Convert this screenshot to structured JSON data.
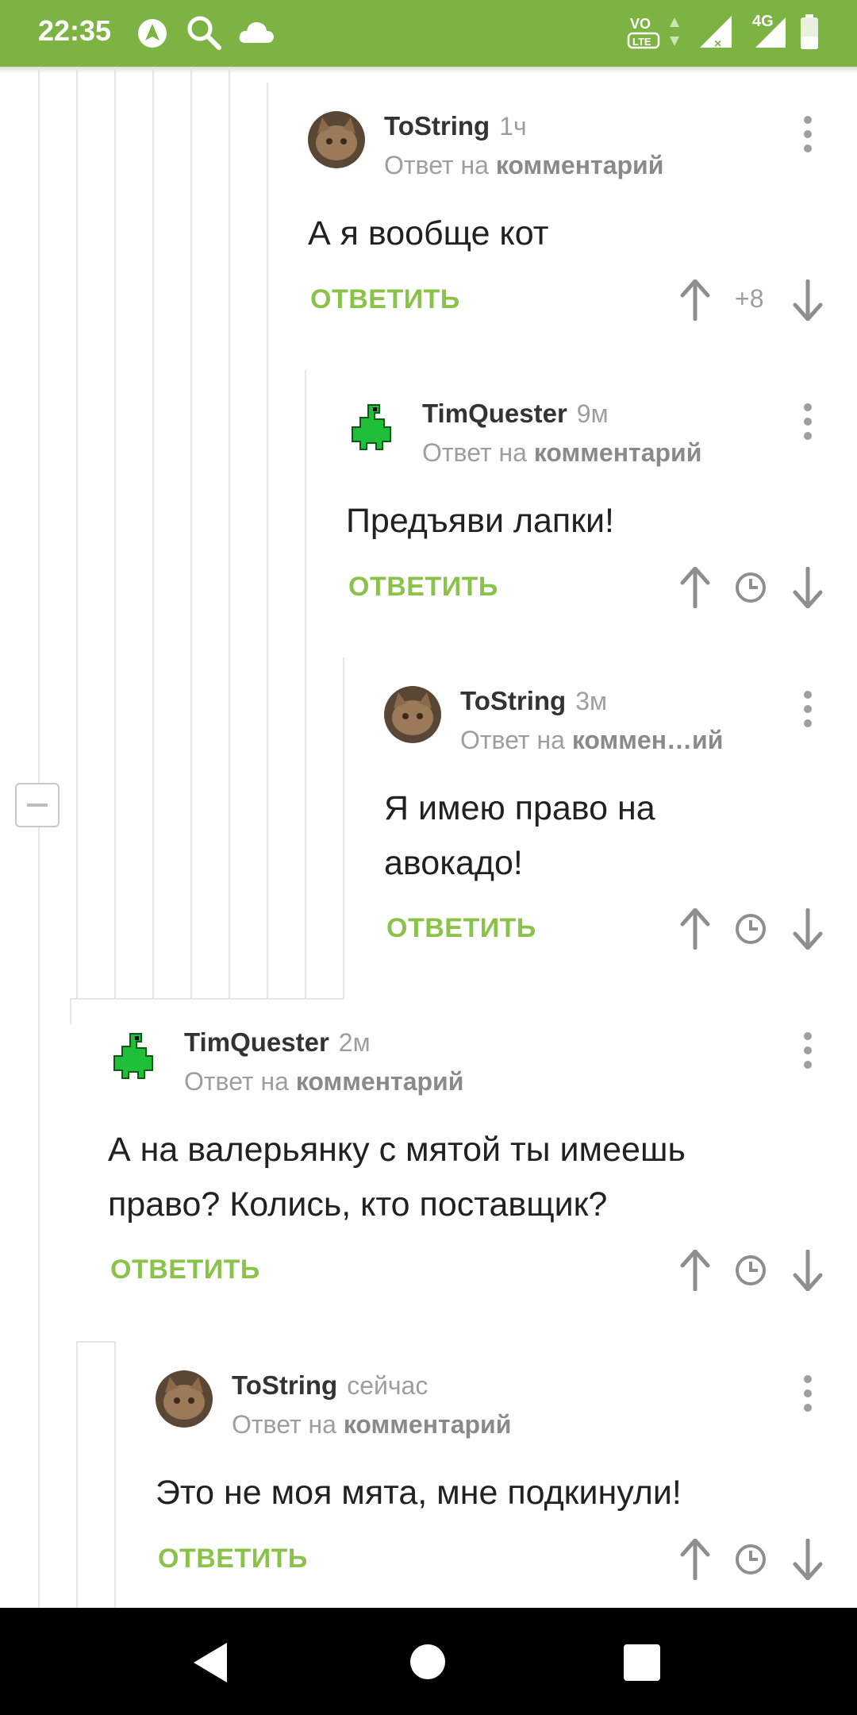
{
  "status_bar": {
    "time": "22:35",
    "network_label": "4G",
    "volte_label": "VoLTE",
    "icons": [
      "navigation-icon",
      "search-icon",
      "cloud-icon",
      "volte-icon",
      "signal-icon",
      "battery-icon"
    ]
  },
  "colors": {
    "accent": "#8bc34a",
    "status_bar": "#7cb342"
  },
  "comments": [
    {
      "author": "ToString",
      "time": "1ч",
      "reply_prefix": "Ответ на",
      "reply_target": "комментарий",
      "text": "А я вообще кот",
      "reply_label": "ОТВЕТИТЬ",
      "rating": "+8"
    },
    {
      "author": "TimQuester",
      "time": "9м",
      "reply_prefix": "Ответ на",
      "reply_target": "комментарий",
      "text": "Предъяви лапки!",
      "reply_label": "ОТВЕТИТЬ"
    },
    {
      "author": "ToString",
      "time": "3м",
      "reply_prefix": "Ответ на",
      "reply_target": "коммен…ий",
      "text_line1": "Я имею право на",
      "text_line2": "авокадо!",
      "reply_label": "ОТВЕТИТЬ"
    },
    {
      "author": "TimQuester",
      "time": "2м",
      "reply_prefix": "Ответ на",
      "reply_target": "комментарий",
      "text_line1": "А на валерьянку с мятой ты имеешь",
      "text_line2": "право? Колись, кто поставщик?",
      "reply_label": "ОТВЕТИТЬ"
    },
    {
      "author": "ToString",
      "time": "сейчас",
      "reply_prefix": "Ответ на",
      "reply_target": "комментарий",
      "text": "Это не моя мята, мне подкинули!",
      "reply_label": "ОТВЕТИТЬ"
    }
  ]
}
